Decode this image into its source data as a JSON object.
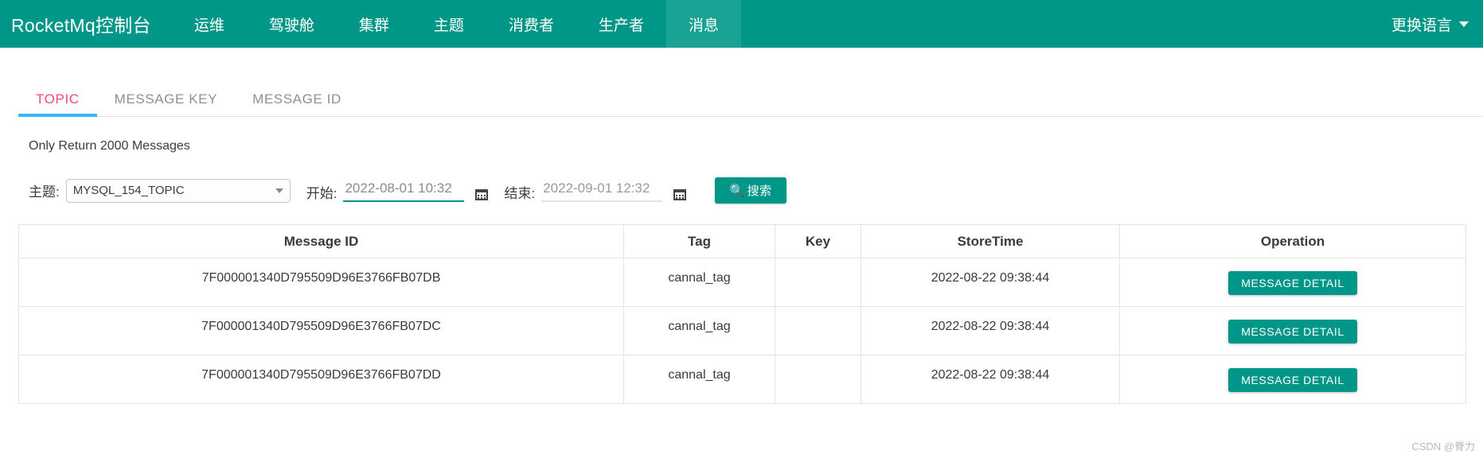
{
  "navbar": {
    "brand": "RocketMq控制台",
    "items": [
      {
        "label": "运维",
        "active": false
      },
      {
        "label": "驾驶舱",
        "active": false
      },
      {
        "label": "集群",
        "active": false
      },
      {
        "label": "主题",
        "active": false
      },
      {
        "label": "消费者",
        "active": false
      },
      {
        "label": "生产者",
        "active": false
      },
      {
        "label": "消息",
        "active": true
      }
    ],
    "language_label": "更换语言",
    "bg_color": "#009688",
    "active_bg_color": "#1aa295"
  },
  "tabs": [
    {
      "label": "TOPIC",
      "active": true
    },
    {
      "label": "MESSAGE KEY",
      "active": false
    },
    {
      "label": "MESSAGE ID",
      "active": false
    }
  ],
  "tab_active_color": "#f2477b",
  "tab_underline_color": "#35b8f0",
  "notice": "Only Return 2000 Messages",
  "filter": {
    "topic_label": "主题:",
    "topic_value": "MYSQL_154_TOPIC",
    "begin_label": "开始:",
    "begin_value": "2022-08-01 10:32",
    "end_label": "结束:",
    "end_value": "2022-09-01 12:32",
    "search_label": "搜索",
    "search_icon": "search-icon",
    "calendar_icon": "calendar-icon"
  },
  "table": {
    "columns": [
      "Message ID",
      "Tag",
      "Key",
      "StoreTime",
      "Operation"
    ],
    "rows": [
      {
        "message_id": "7F000001340D795509D96E3766FB07DB",
        "tag": "cannal_tag",
        "key": "",
        "store_time": "2022-08-22 09:38:44",
        "operation": "MESSAGE DETAIL"
      },
      {
        "message_id": "7F000001340D795509D96E3766FB07DC",
        "tag": "cannal_tag",
        "key": "",
        "store_time": "2022-08-22 09:38:44",
        "operation": "MESSAGE DETAIL"
      },
      {
        "message_id": "7F000001340D795509D96E3766FB07DD",
        "tag": "cannal_tag",
        "key": "",
        "store_time": "2022-08-22 09:38:44",
        "operation": "MESSAGE DETAIL"
      }
    ]
  },
  "watermark": "CSDN @脊力"
}
